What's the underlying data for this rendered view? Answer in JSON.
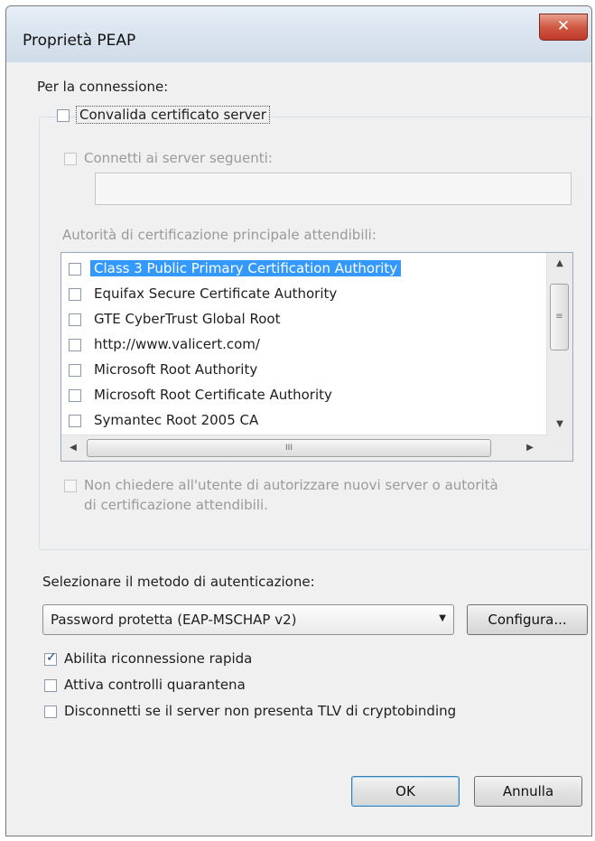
{
  "window": {
    "title": "Proprietà PEAP",
    "close_glyph": "✕"
  },
  "connection": {
    "section_label": "Per la connessione:",
    "validate_cert": {
      "label": "Convalida certificato server",
      "checked": false
    },
    "connect_servers": {
      "label": "Connetti ai server seguenti:",
      "checked": false,
      "value": ""
    },
    "ca_label": "Autorità di certificazione principale attendibili:",
    "ca_list": [
      {
        "label": "Class 3 Public Primary Certification Authority",
        "checked": false,
        "selected": true
      },
      {
        "label": "Equifax Secure Certificate Authority",
        "checked": false,
        "selected": false
      },
      {
        "label": "GTE CyberTrust Global Root",
        "checked": false,
        "selected": false
      },
      {
        "label": "http://www.valicert.com/",
        "checked": false,
        "selected": false
      },
      {
        "label": "Microsoft Root Authority",
        "checked": false,
        "selected": false
      },
      {
        "label": "Microsoft Root Certificate Authority",
        "checked": false,
        "selected": false
      },
      {
        "label": "Symantec Root 2005 CA",
        "checked": false,
        "selected": false
      }
    ],
    "scrollbar_glyphs": {
      "up": "▲",
      "down": "▼",
      "left": "◀",
      "right": "▶",
      "grip_v": "≡",
      "grip_h": "III"
    },
    "no_prompt": {
      "line1": "Non chiedere all'utente di autorizzare nuovi server o autorità",
      "line2": "di certificazione attendibili.",
      "checked": false
    }
  },
  "auth": {
    "method_label": "Selezionare il metodo di autenticazione:",
    "method_value": "Password protetta (EAP-MSCHAP v2)",
    "dropdown_glyph": "▼",
    "configure_label": "Configura..."
  },
  "options": [
    {
      "label": "Abilita riconnessione rapida",
      "checked": true
    },
    {
      "label": "Attiva controlli quarantena",
      "checked": false
    },
    {
      "label": "Disconnetti se il server non presenta TLV di cryptobinding",
      "checked": false
    }
  ],
  "buttons": {
    "ok": "OK",
    "cancel": "Annulla"
  }
}
